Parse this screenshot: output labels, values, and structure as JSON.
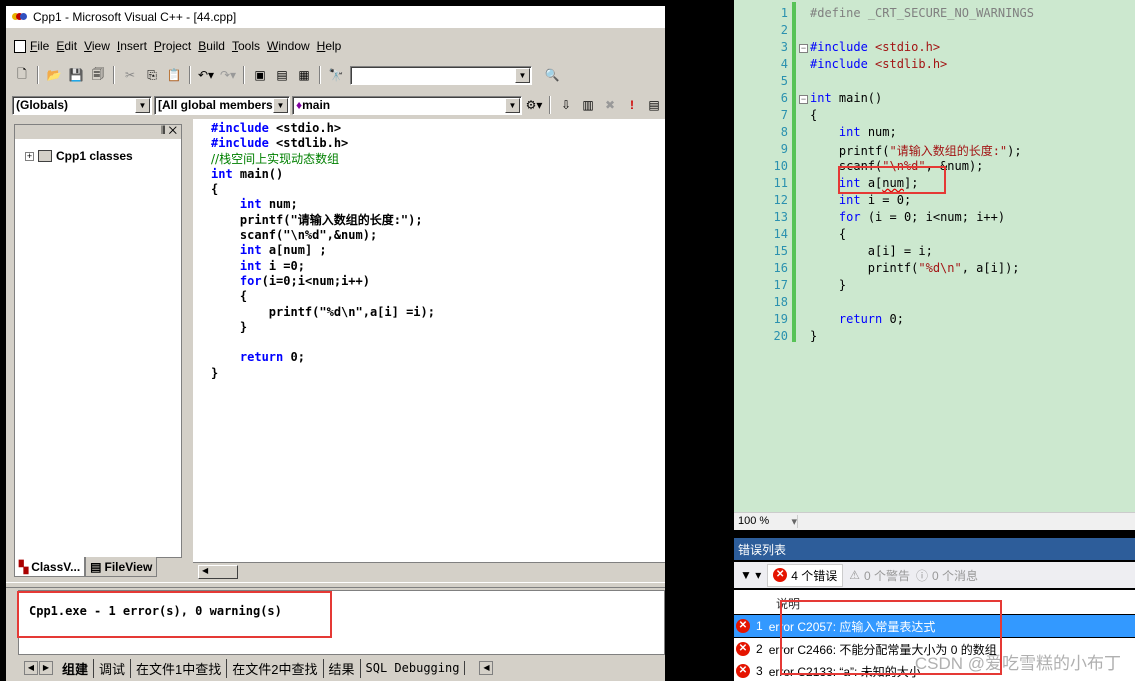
{
  "vc6": {
    "title": "Cpp1 - Microsoft Visual C++ - [44.cpp]",
    "menu": [
      "File",
      "Edit",
      "View",
      "Insert",
      "Project",
      "Build",
      "Tools",
      "Window",
      "Help"
    ],
    "combo_globals": "(Globals)",
    "combo_members": "[All global members",
    "combo_main": "main",
    "tree_root": "Cpp1 classes",
    "panel_tabs": [
      "ClassV...",
      "FileView"
    ],
    "code_lines": [
      "#include <stdio.h>",
      "#include <stdlib.h>",
      "//栈空间上实现动态数组",
      "int main()",
      "{",
      "    int num;",
      "    printf(\"请输入数组的长度:\");",
      "    scanf(\"\\n%d\",&num);",
      "    int a[num] ;",
      "    int i =0;",
      "    for(i=0;i<num;i++)",
      "    {",
      "        printf(\"%d\\n\",a[i] =i);",
      "    }",
      "",
      "    return 0;",
      "}"
    ],
    "output_text": "Cpp1.exe - 1 error(s), 0 warning(s)",
    "output_tabs": [
      "组建",
      "调试",
      "在文件1中查找",
      "在文件2中查找",
      "结果",
      "SQL Debugging"
    ]
  },
  "vs": {
    "line_numbers": [
      "1",
      "2",
      "3",
      "4",
      "5",
      "6",
      "7",
      "8",
      "9",
      "10",
      "11",
      "12",
      "13",
      "14",
      "15",
      "16",
      "17",
      "18",
      "19",
      "20"
    ],
    "code_lines": [
      "#define _CRT_SECURE_NO_WARNINGS",
      "",
      "#include <stdio.h>",
      "#include <stdlib.h>",
      "",
      "int main()",
      "{",
      "    int num;",
      "    printf(\"请输入数组的长度:\");",
      "    scanf(\"\\n%d\", &num);",
      "    int a[num];",
      "    int i = 0;",
      "    for (i = 0; i<num; i++)",
      "    {",
      "        a[i] = i;",
      "        printf(\"%d\\n\", a[i]);",
      "    }",
      "",
      "    return 0;",
      "}"
    ],
    "zoom": "100 %",
    "error_list_title": "错误列表",
    "filter_errors": "4 个错误",
    "filter_warnings": "0 个警告",
    "filter_messages": "0 个消息",
    "col_description": "说明",
    "errors": [
      {
        "num": "1",
        "text": "error C2057: 应输入常量表达式"
      },
      {
        "num": "2",
        "text": "error C2466: 不能分配常量大小为 0 的数组"
      },
      {
        "num": "3",
        "text": "error C2133: “a”: 未知的大小"
      }
    ],
    "watermark": "CSDN @爱吃雪糕的小布丁"
  }
}
